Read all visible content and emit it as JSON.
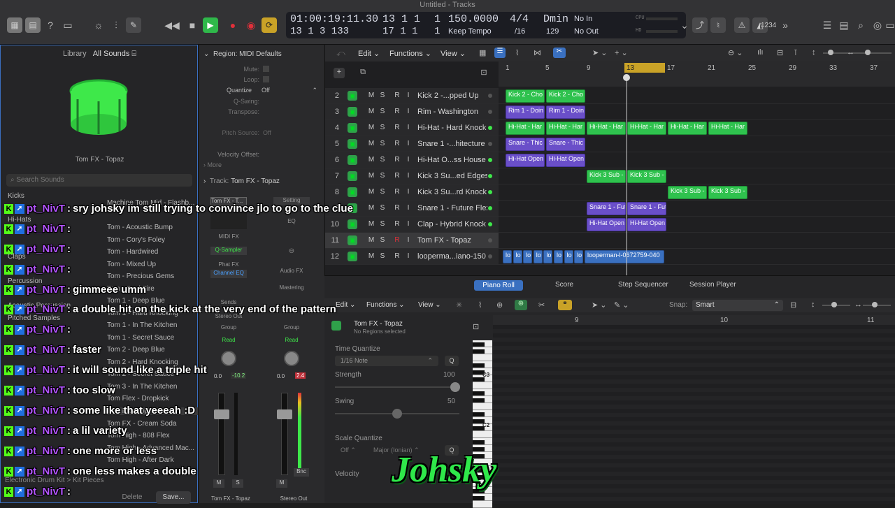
{
  "window": {
    "title": "Untitled - Tracks"
  },
  "lcd": {
    "time": "01:00:19:11.30",
    "bars": "13  1  1",
    "ticks1": "1",
    "tempo": "150.0000",
    "sig": "4/4",
    "key": "Dmin",
    "in": "No In",
    "time2": "13  1  3  133",
    "bars2": "17  1  1",
    "ticks2": "1",
    "tempo_mode": "Keep Tempo",
    "div": "/16",
    "key2": "129",
    "out": "No Out",
    "cpu": "CPU",
    "hd": "HD"
  },
  "toolbar": {
    "count": "1234"
  },
  "library": {
    "title": "Library",
    "all_sounds": "All Sounds ⌸",
    "patch": "Tom FX - Topaz",
    "search_placeholder": "Search Sounds",
    "categories": [
      "Kicks",
      "Hi-Hats",
      "Claps",
      "Percussion",
      "Acoustic Percussion",
      "Pitched Samples"
    ],
    "items": [
      "Machine Tom Mid - Flashb...",
      "Tom - Acoustic Bump",
      "Tom - Cory's Foley",
      "Tom - Hardwired",
      "Tom - Mixed Up",
      "Tom - Precious Gems",
      "Tom - Soul Fire",
      "Tom 1 - Deep Blue",
      "Tom 1 - Hard Knocking",
      "Tom 1 - In The Kitchen",
      "Tom 1 - Secret Sauce",
      "Tom 2 - Deep Blue",
      "Tom 2 - Hard Knocking",
      "Tom 2 - Secret Sauce",
      "Tom 3 - In The Kitchen",
      "Tom Flex - Dropkick",
      "Tom FX - Topaz",
      "Tom FX - Cream Soda",
      "Tom High - 808 Flex",
      "Tom High - Advanced Mac...",
      "Tom High - After Dark"
    ],
    "footer_kit": "Electronic Drum Kit",
    "footer_pieces": "Kit Pieces",
    "delete": "Delete",
    "save": "Save..."
  },
  "inspector": {
    "region": "Region: MIDI Defaults",
    "mute": "Mute:",
    "loop": "Loop:",
    "quantize": "Quantize",
    "quantize_val": "Off",
    "qswing": "Q-Swing:",
    "transpose": "Transpose:",
    "pitch_source": "Pitch Source:",
    "pitch_val": "Off",
    "velocity": "Velocity Offset:",
    "more": "More",
    "track": "Track:",
    "track_name": "Tom FX - Topaz",
    "strip1_name": "Tom FX - T...",
    "setting": "Setting",
    "eq": "EQ",
    "midi_fx": "MIDI FX",
    "q_sampler": "Q-Sampler",
    "phat_fx": "Phat FX",
    "channel_eq": "Channel EQ",
    "audio_fx": "Audio FX",
    "mastering": "Mastering",
    "sends": "Sends",
    "stereo_out": "Stereo Out",
    "group": "Group",
    "read": "Read",
    "vol1a": "0.0",
    "vol1b": "-10.2",
    "vol2a": "0.0",
    "vol2b": "2.4",
    "bnc": "Bnc",
    "m": "M",
    "s": "S",
    "name1": "Tom FX - Topaz",
    "name2": "Stereo Out"
  },
  "tracks_header": {
    "edit": "Edit",
    "functions": "Functions",
    "view": "View"
  },
  "ruler": [
    "1",
    "5",
    "9",
    "13",
    "17",
    "21",
    "25",
    "29",
    "33",
    "37"
  ],
  "tracks": [
    {
      "num": "2",
      "name": "Kick 2 -...pped Up"
    },
    {
      "num": "3",
      "name": "Rim - Washington"
    },
    {
      "num": "4",
      "name": "Hi-Hat - Hard Knock"
    },
    {
      "num": "5",
      "name": "Snare 1 -...hitecture"
    },
    {
      "num": "6",
      "name": "Hi-Hat O...ss House"
    },
    {
      "num": "7",
      "name": "Kick 3 Su...ed Edges"
    },
    {
      "num": "8",
      "name": "Kick 3 Su...rd Knock"
    },
    {
      "num": "9",
      "name": "Snare 1 - Future Flex"
    },
    {
      "num": "10",
      "name": "Clap - Hybrid Knock"
    },
    {
      "num": "11",
      "name": "Tom FX - Topaz"
    },
    {
      "num": "12",
      "name": "looperma...iano-150"
    }
  ],
  "track_btns": {
    "m": "M",
    "s": "S",
    "r": "R",
    "i": "I"
  },
  "regions": {
    "r2": "Kick 2 - Cho",
    "r3": "Rim 1 - Doin",
    "r4": "Hi-Hat - Har",
    "r5": "Snare - Thic",
    "r6": "Hi-Hat Open",
    "r7": "Kick 3 Sub -",
    "r9": "Snare 1 - Fut",
    "r10": "Hi-Hat Open",
    "r12a": "lo",
    "r12b": "looperman-l-0672759-040"
  },
  "editor": {
    "tabs": [
      "Piano Roll",
      "Score",
      "Step Sequencer",
      "Session Player"
    ],
    "edit": "Edit",
    "functions": "Functions",
    "view": "View",
    "snap": "Snap:",
    "snap_val": "Smart",
    "track": "Tom FX - Topaz",
    "no_regions": "No Regions selected",
    "time_quantize": "Time Quantize",
    "note": "1/16 Note",
    "q": "Q",
    "strength": "Strength",
    "strength_val": "100",
    "swing": "Swing",
    "swing_val": "50",
    "scale_quantize": "Scale Quantize",
    "scale_off": "Off",
    "scale_major": "Major (Ionian)",
    "velocity": "Velocity",
    "c3": "C3",
    "c2": "C2",
    "ruler": [
      "9",
      "10",
      "11"
    ]
  },
  "chat": {
    "user": "pt_NivT",
    "sep": ":",
    "messages": [
      "sry johsky im still trying to convince jlo to go to the clue",
      "",
      "",
      "",
      "gimmeee umm",
      "a double hit on the kick at the very end of the pattern",
      "",
      "faster",
      "it will sound like a triple hit",
      "too slow",
      "some like that yeeeah :D",
      "a lil variety",
      "one more or less",
      "one less makes a double",
      ""
    ]
  },
  "watermark": "Johsky"
}
